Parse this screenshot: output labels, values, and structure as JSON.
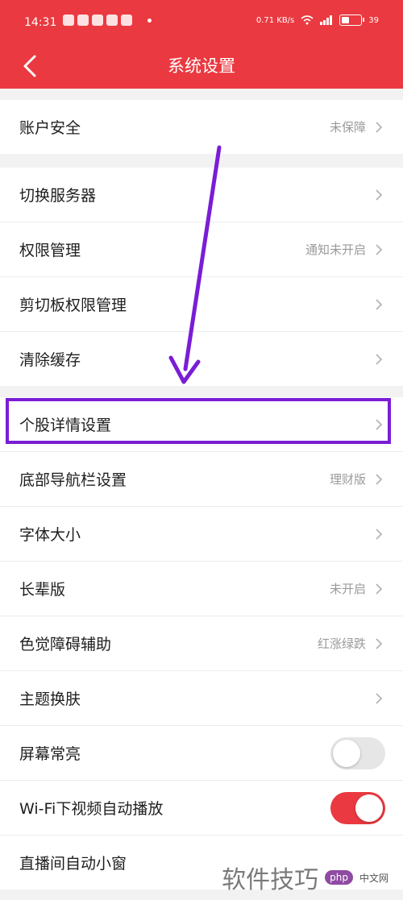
{
  "status_bar": {
    "time": "14:31",
    "network": "0.71 KB/s",
    "battery": "39"
  },
  "header": {
    "title": "系统设置"
  },
  "groups": [
    [
      {
        "label": "账户安全",
        "value": "未保障",
        "chevron": true
      }
    ],
    [
      {
        "label": "切换服务器",
        "value": "",
        "chevron": true
      },
      {
        "label": "权限管理",
        "value": "通知未开启",
        "chevron": true
      },
      {
        "label": "剪切板权限管理",
        "value": "",
        "chevron": true
      },
      {
        "label": "清除缓存",
        "value": "",
        "chevron": true
      }
    ],
    [
      {
        "label": "个股详情设置",
        "value": "",
        "chevron": true
      },
      {
        "label": "底部导航栏设置",
        "value": "理财版",
        "chevron": true
      },
      {
        "label": "字体大小",
        "value": "",
        "chevron": true
      },
      {
        "label": "长辈版",
        "value": "未开启",
        "chevron": true
      },
      {
        "label": "色觉障碍辅助",
        "value": "红涨绿跌",
        "chevron": true
      },
      {
        "label": "主题换肤",
        "value": "",
        "chevron": true
      },
      {
        "label": "屏幕常亮",
        "toggle": false
      },
      {
        "label": "Wi-Fi下视频自动播放",
        "toggle": true
      },
      {
        "label": "直播间自动小窗"
      }
    ]
  ],
  "watermark": {
    "main": "软件技巧",
    "logo": "php",
    "site": "中文网"
  },
  "colors": {
    "accent": "#ea3940",
    "annotation": "#7a1dd6"
  }
}
